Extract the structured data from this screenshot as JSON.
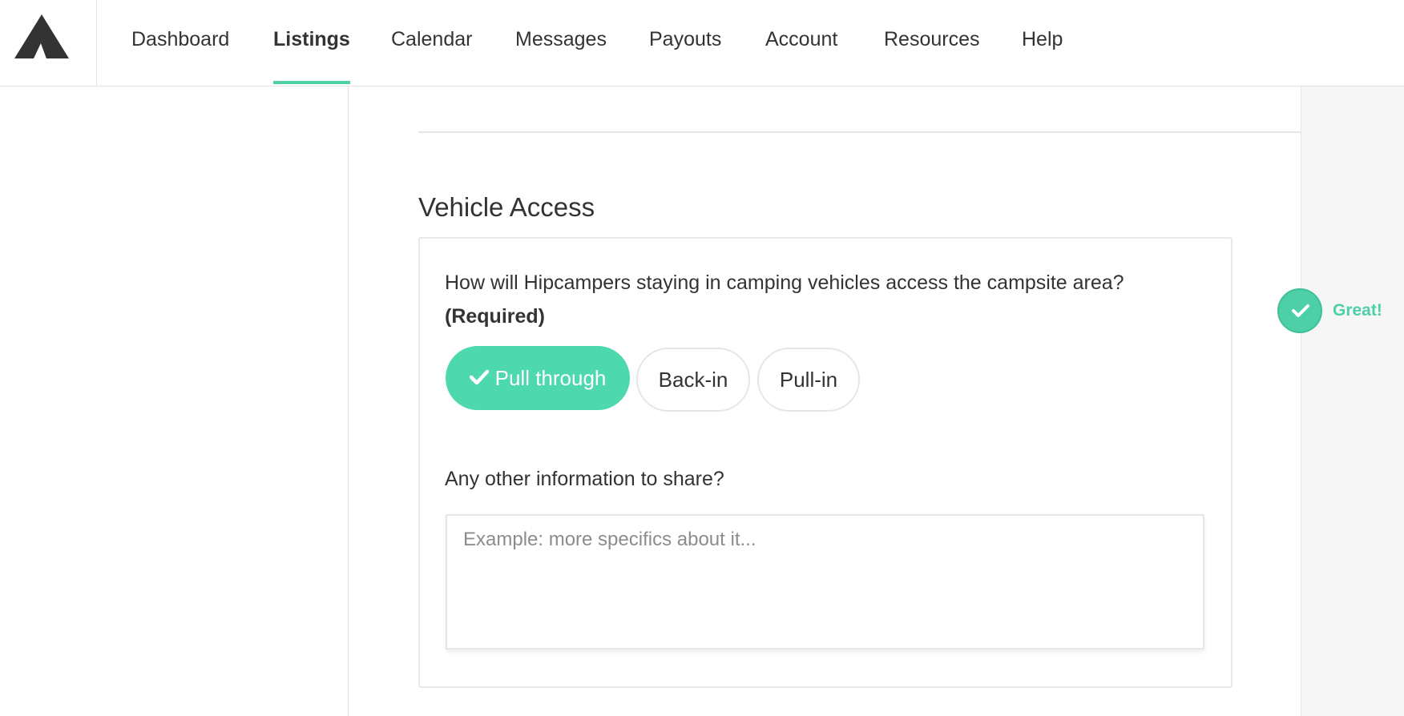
{
  "colors": {
    "accent": "#4dd0a8",
    "chip_selected_bg": "#4dd9ad",
    "text": "#333333",
    "border": "#e6e6e6",
    "right_panel_bg": "#f6f6f6"
  },
  "header": {
    "logo_icon": "hipcamp-tent-logo",
    "nav": [
      {
        "label": "Dashboard",
        "active": false
      },
      {
        "label": "Listings",
        "active": true
      },
      {
        "label": "Calendar",
        "active": false
      },
      {
        "label": "Messages",
        "active": false
      },
      {
        "label": "Payouts",
        "active": false
      },
      {
        "label": "Account",
        "active": false
      },
      {
        "label": "Resources",
        "active": false
      },
      {
        "label": "Help",
        "active": false
      }
    ]
  },
  "section": {
    "title": "Vehicle Access",
    "question": "How will Hipcampers staying in camping vehicles access the campsite area?",
    "required_label": "(Required)",
    "options": [
      {
        "label": "Pull through",
        "selected": true
      },
      {
        "label": "Back-in",
        "selected": false
      },
      {
        "label": "Pull-in",
        "selected": false
      }
    ],
    "other_label": "Any other information to share?",
    "other_value": "",
    "other_placeholder": "Example: more specifics about it..."
  },
  "status": {
    "icon": "check-circle-icon",
    "text": "Great!"
  }
}
